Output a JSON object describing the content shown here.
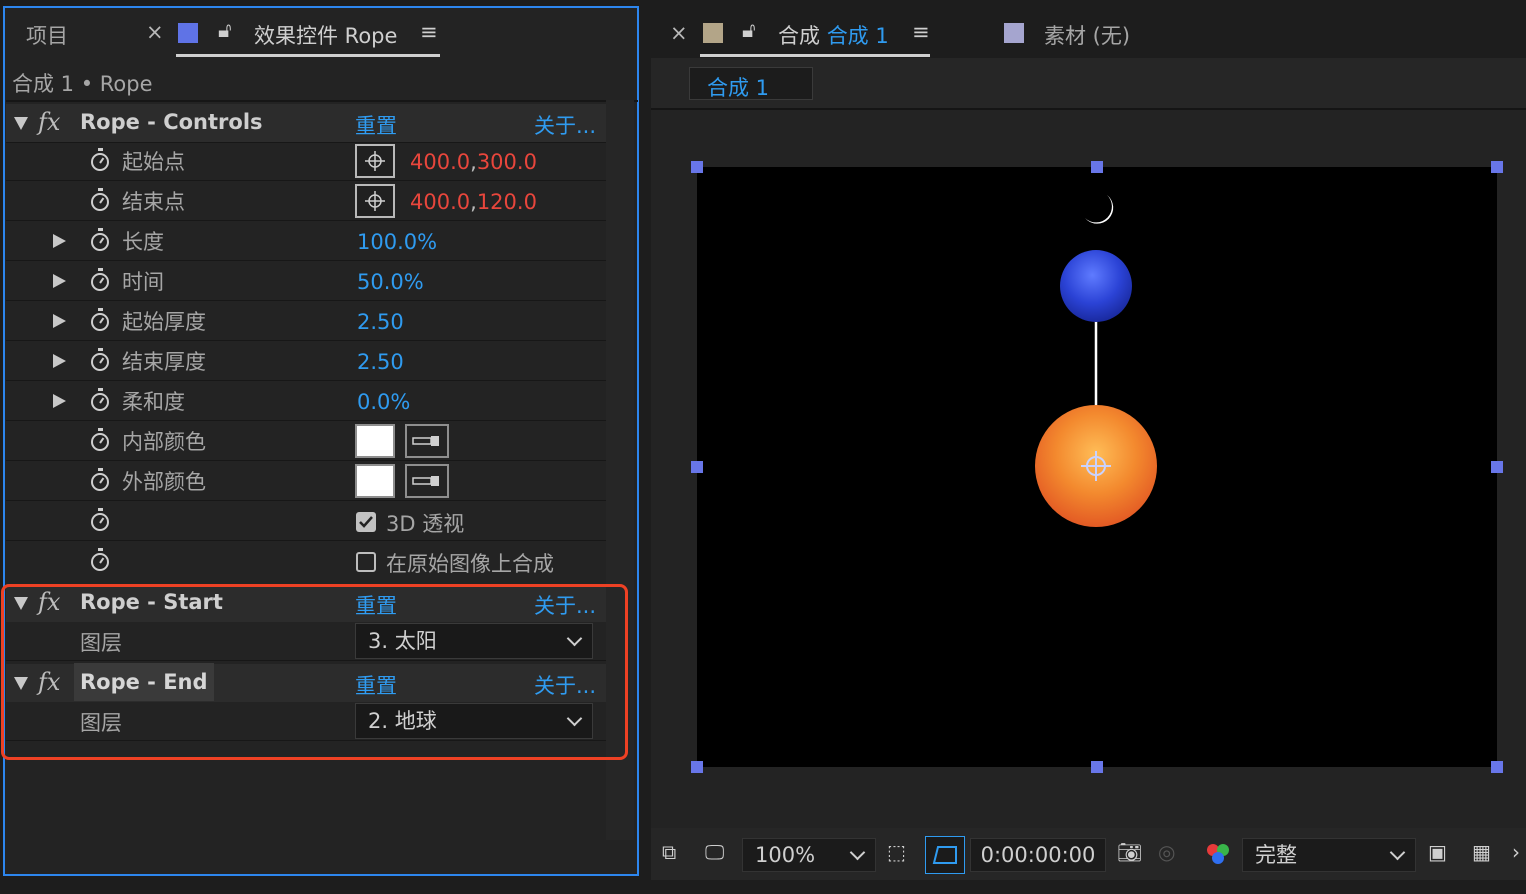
{
  "left_panel": {
    "tab_project": "项目",
    "tab_effect_controls": "效果控件 Rope",
    "breadcrumb": "合成 1 • Rope",
    "effects": [
      {
        "name": "Rope - Controls",
        "reset": "重置",
        "about": "关于...",
        "properties": [
          {
            "label": "起始点",
            "value_x": "400.0",
            "value_y": "300.0"
          },
          {
            "label": "结束点",
            "value_x": "400.0",
            "value_y": "120.0"
          },
          {
            "label": "长度",
            "value": "100.0%"
          },
          {
            "label": "时间",
            "value": "50.0%"
          },
          {
            "label": "起始厚度",
            "value": "2.50"
          },
          {
            "label": "结束厚度",
            "value": "2.50"
          },
          {
            "label": "柔和度",
            "value": "0.0%"
          },
          {
            "label": "内部颜色",
            "color": "#ffffff"
          },
          {
            "label": "外部颜色",
            "color": "#ffffff"
          },
          {
            "label": "",
            "checkbox": "3D 透视",
            "checked": true
          },
          {
            "label": "",
            "checkbox": "在原始图像上合成",
            "checked": false
          }
        ]
      },
      {
        "name": "Rope - Start",
        "reset": "重置",
        "about": "关于...",
        "layer_label": "图层",
        "layer_value": "3. 太阳"
      },
      {
        "name": "Rope - End",
        "reset": "重置",
        "about": "关于...",
        "layer_label": "图层",
        "layer_value": "2. 地球"
      }
    ]
  },
  "right_panel": {
    "tab_comp_prefix": "合成",
    "tab_comp_name": "合成 1",
    "tab_footage": "素材  (无)",
    "subtab": "合成 1",
    "toolbar": {
      "zoom": "100%",
      "timecode": "0:00:00:00",
      "quality": "完整"
    }
  },
  "colors": {
    "accent_blue": "#2f9bf0",
    "value_red": "#e8463c",
    "highlight_box": "#ee4124",
    "handle": "#6876e8"
  }
}
